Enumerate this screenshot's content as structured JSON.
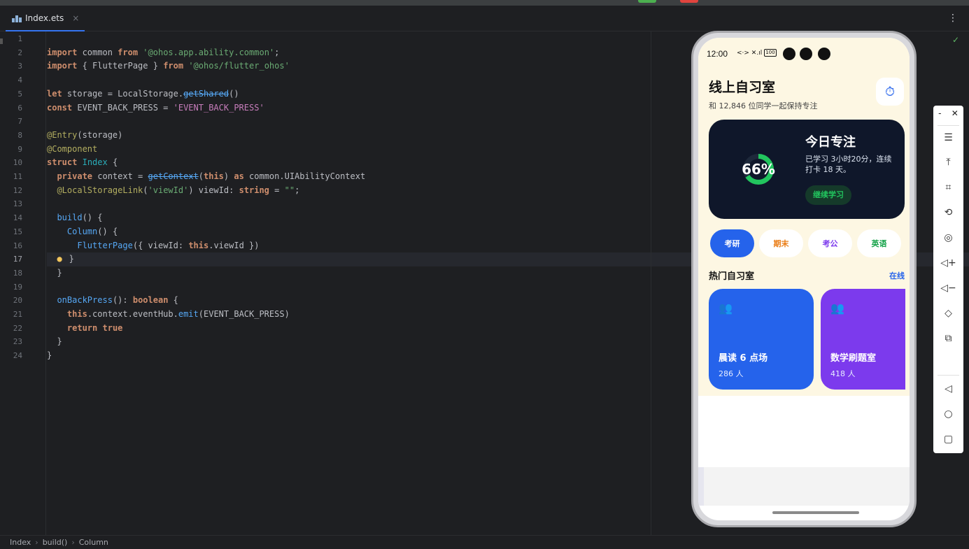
{
  "editor": {
    "tab_label": "Index.ets",
    "tab_close": "×",
    "menu_glyph": "⋮",
    "line_numbers": [
      "1",
      "2",
      "3",
      "4",
      "5",
      "6",
      "7",
      "8",
      "9",
      "10",
      "11",
      "12",
      "13",
      "14",
      "15",
      "16",
      "17",
      "18",
      "19",
      "20",
      "21",
      "22",
      "23",
      "24"
    ],
    "current_line": 17,
    "status_glyph": "✓"
  },
  "breadcrumb": {
    "items": [
      "Index",
      "build()",
      "Column"
    ],
    "separator": "›"
  },
  "phone": {
    "status": {
      "time": "12:00",
      "icons": "<·> ✕.ıl",
      "battery": "100"
    },
    "app_title": "线上自习室",
    "app_subtitle": "和 12,846 位同学一起保持专注",
    "timer_glyph": "⏱",
    "focus_card": {
      "progress_label": "66%",
      "progress_value": 0.66,
      "title": "今日专注",
      "description": "已学习 3小时20分，连续打卡 18 天。",
      "button": "继续学习"
    },
    "chips": [
      {
        "label": "考研",
        "active": true,
        "bg": "#2563eb",
        "fg": "#ffffff"
      },
      {
        "label": "期末",
        "active": false,
        "bg": "#ffffff",
        "fg": "#ea7b12"
      },
      {
        "label": "考公",
        "active": false,
        "bg": "#ffffff",
        "fg": "#7c3aed"
      },
      {
        "label": "英语",
        "active": false,
        "bg": "#ffffff",
        "fg": "#16a34a"
      }
    ],
    "section_title": "热门自习室",
    "section_link": "在线",
    "rooms": [
      {
        "name": "晨读 6 点场",
        "count": "286 人",
        "color": "#2563eb"
      },
      {
        "name": "数学刷题室",
        "count": "418 人",
        "color": "#7c3aed"
      }
    ]
  },
  "emulator_toolbar": {
    "minimize": "-",
    "close": "✕",
    "tools": [
      "menu-icon",
      "pin-top-icon",
      "crop-icon",
      "rotate-icon",
      "location-icon",
      "volume-up-icon",
      "volume-down-icon",
      "shake-icon",
      "multi-device-icon"
    ],
    "nav": [
      "back-icon",
      "home-icon",
      "recents-icon"
    ]
  },
  "colors": {
    "ide_bg": "#1e1f22",
    "keyword": "#cf8e6d",
    "string": "#6aab73",
    "annotation": "#b3ae60",
    "accent_blue": "#3574f0",
    "app_bg": "#fdf7e3",
    "focus_card_bg": "#0f172a",
    "progress_green": "#22c55e"
  }
}
